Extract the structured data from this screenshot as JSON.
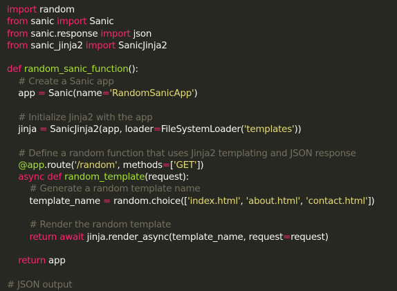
{
  "editor": {
    "colors": {
      "background": "#272822",
      "keyword": "#f92672",
      "function": "#a6e22e",
      "string": "#e6db74",
      "comment": "#75715e",
      "text": "#f8f8f2"
    },
    "lines": [
      [
        {
          "t": "import",
          "c": "kw"
        },
        {
          "t": " random",
          "c": "tx"
        }
      ],
      [
        {
          "t": "from",
          "c": "kw"
        },
        {
          "t": " sanic ",
          "c": "tx"
        },
        {
          "t": "import",
          "c": "kw"
        },
        {
          "t": " Sanic",
          "c": "tx"
        }
      ],
      [
        {
          "t": "from",
          "c": "kw"
        },
        {
          "t": " sanic.response ",
          "c": "tx"
        },
        {
          "t": "import",
          "c": "kw"
        },
        {
          "t": " json",
          "c": "tx"
        }
      ],
      [
        {
          "t": "from",
          "c": "kw"
        },
        {
          "t": " sanic_jinja2 ",
          "c": "tx"
        },
        {
          "t": "import",
          "c": "kw"
        },
        {
          "t": " SanicJinja2",
          "c": "tx"
        }
      ],
      [],
      [
        {
          "t": "def",
          "c": "kw"
        },
        {
          "t": " ",
          "c": "tx"
        },
        {
          "t": "random_sanic_function",
          "c": "fn"
        },
        {
          "t": "():",
          "c": "tx"
        }
      ],
      [
        {
          "t": "    ",
          "c": "tx"
        },
        {
          "t": "# Create a Sanic app",
          "c": "cm"
        }
      ],
      [
        {
          "t": "    app ",
          "c": "tx"
        },
        {
          "t": "=",
          "c": "op"
        },
        {
          "t": " Sanic(name",
          "c": "tx"
        },
        {
          "t": "=",
          "c": "op"
        },
        {
          "t": "'RandomSanicApp'",
          "c": "str"
        },
        {
          "t": ")",
          "c": "tx"
        }
      ],
      [],
      [
        {
          "t": "    ",
          "c": "tx"
        },
        {
          "t": "# Initialize Jinja2 with the app",
          "c": "cm"
        }
      ],
      [
        {
          "t": "    jinja ",
          "c": "tx"
        },
        {
          "t": "=",
          "c": "op"
        },
        {
          "t": " SanicJinja2(app, loader",
          "c": "tx"
        },
        {
          "t": "=",
          "c": "op"
        },
        {
          "t": "FileSystemLoader(",
          "c": "tx"
        },
        {
          "t": "'templates'",
          "c": "str"
        },
        {
          "t": "))",
          "c": "tx"
        }
      ],
      [],
      [
        {
          "t": "    ",
          "c": "tx"
        },
        {
          "t": "# Define a random function that uses Jinja2 templating and JSON response",
          "c": "cm"
        }
      ],
      [
        {
          "t": "    ",
          "c": "tx"
        },
        {
          "t": "@app",
          "c": "fn"
        },
        {
          "t": ".route(",
          "c": "tx"
        },
        {
          "t": "'/random'",
          "c": "str"
        },
        {
          "t": ", methods",
          "c": "tx"
        },
        {
          "t": "=",
          "c": "op"
        },
        {
          "t": "[",
          "c": "tx"
        },
        {
          "t": "'GET'",
          "c": "str"
        },
        {
          "t": "])",
          "c": "tx"
        }
      ],
      [
        {
          "t": "    ",
          "c": "tx"
        },
        {
          "t": "async def",
          "c": "kw"
        },
        {
          "t": " ",
          "c": "tx"
        },
        {
          "t": "random_template",
          "c": "fn"
        },
        {
          "t": "(request):",
          "c": "tx"
        }
      ],
      [
        {
          "t": "        ",
          "c": "tx"
        },
        {
          "t": "# Generate a random template name",
          "c": "cm"
        }
      ],
      [
        {
          "t": "        template_name ",
          "c": "tx"
        },
        {
          "t": "=",
          "c": "op"
        },
        {
          "t": " random.choice([",
          "c": "tx"
        },
        {
          "t": "'index.html'",
          "c": "str"
        },
        {
          "t": ", ",
          "c": "tx"
        },
        {
          "t": "'about.html'",
          "c": "str"
        },
        {
          "t": ", ",
          "c": "tx"
        },
        {
          "t": "'contact.html'",
          "c": "str"
        },
        {
          "t": "])",
          "c": "tx"
        }
      ],
      [],
      [
        {
          "t": "        ",
          "c": "tx"
        },
        {
          "t": "# Render the random template",
          "c": "cm"
        }
      ],
      [
        {
          "t": "        ",
          "c": "tx"
        },
        {
          "t": "return await",
          "c": "kw"
        },
        {
          "t": " jinja.render_async(template_name, request",
          "c": "tx"
        },
        {
          "t": "=",
          "c": "op"
        },
        {
          "t": "request)",
          "c": "tx"
        }
      ],
      [],
      [
        {
          "t": "    ",
          "c": "tx"
        },
        {
          "t": "return",
          "c": "kw"
        },
        {
          "t": " app",
          "c": "tx"
        }
      ],
      [],
      [
        {
          "t": "# JSON output",
          "c": "cm"
        }
      ]
    ]
  }
}
